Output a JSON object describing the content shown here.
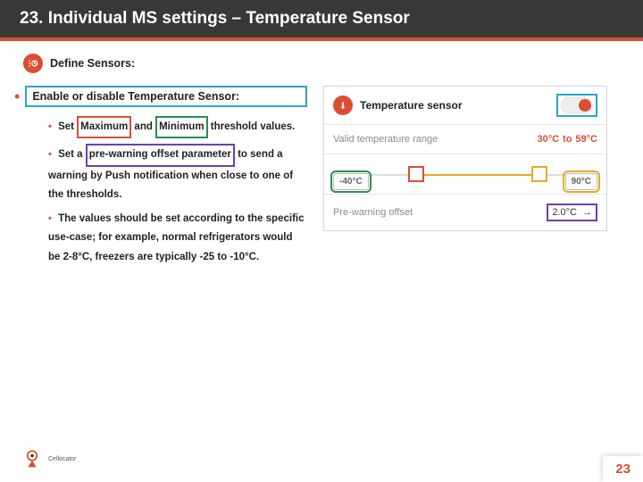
{
  "header": {
    "title": "23. Individual MS settings – Temperature Sensor"
  },
  "define": {
    "label": "Define Sensors:"
  },
  "bullets": {
    "enable_label": "Enable or disable Temperature Sensor:",
    "subs": [
      {
        "pre": "Set",
        "hl1": "Maximum",
        "mid": "and",
        "hl2": "Minimum",
        "post": "threshold values."
      },
      {
        "pre": "Set a",
        "hl1": "pre-warning offset parameter",
        "post": "to send a warning by Push notification when close to one of the thresholds."
      },
      {
        "pre": "The values should be set according to the specific use-case; for example, normal refrigerators would be 2-8°C, freezers are typically -25 to -10°C."
      }
    ]
  },
  "phone": {
    "title": "Temperature sensor",
    "range_label": "Valid temperature range",
    "range_low": "30°C",
    "range_to": "to",
    "range_high": "59°C",
    "chip_min": "-40°C",
    "chip_max": "90°C",
    "offset_label": "Pre-warning offset",
    "offset_value": "2.0°C",
    "arrow": "→"
  },
  "page_number": "23",
  "brand": "Cellocator"
}
